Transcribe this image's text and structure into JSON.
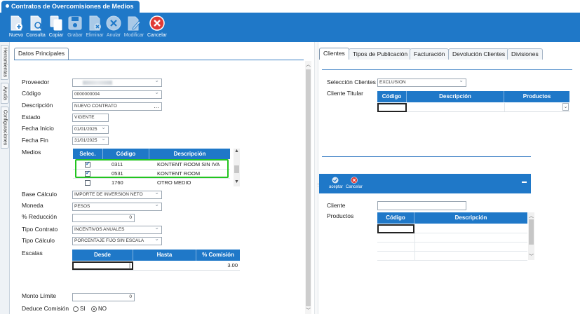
{
  "window": {
    "tab_title": "Contratos de Overcomisiones de Medios"
  },
  "toolbar": [
    {
      "id": "nuevo",
      "label": "Nuevo",
      "icon": "new-document-icon"
    },
    {
      "id": "consulta",
      "label": "Consulta",
      "icon": "search-document-icon"
    },
    {
      "id": "copiar",
      "label": "Copiar",
      "icon": "copy-icon"
    },
    {
      "id": "grabar",
      "label": "Grabar",
      "icon": "save-icon"
    },
    {
      "id": "eliminar",
      "label": "Eliminar",
      "icon": "delete-document-icon"
    },
    {
      "id": "anular",
      "label": "Anular",
      "icon": "cancel-x-icon"
    },
    {
      "id": "modificar",
      "label": "Modificar",
      "icon": "edit-document-icon"
    },
    {
      "id": "cancelar",
      "label": "Cancelar",
      "icon": "red-cancel-icon"
    }
  ],
  "sidebar_tabs": [
    "Herramientas",
    "Ayuda",
    "Configuraciones"
  ],
  "left_panel": {
    "tab": "Datos Principales",
    "labels": {
      "proveedor": "Proveedor",
      "codigo": "Código",
      "descripcion": "Descripción",
      "estado": "Estado",
      "fecha_inicio": "Fecha Inicio",
      "fecha_fin": "Fecha Fin",
      "medios": "Medios",
      "base_calculo": "Base Cálculo",
      "moneda": "Moneda",
      "reduccion": "% Reducción",
      "tipo_contrato": "Tipo Contrato",
      "tipo_calculo": "Tipo Cálculo",
      "escalas": "Escalas",
      "monto_limite": "Monto Límite",
      "deduce_comision": "Deduce Comisión"
    },
    "values": {
      "codigo": "0000000004",
      "descripcion": "NUEVO CONTRATO",
      "estado": "VIGENTE",
      "fecha_inicio": "01/01/2025",
      "fecha_fin": "31/01/2025",
      "base_calculo": "IMPORTE DE INVERSION NETO",
      "moneda": "PESOS",
      "reduccion": "0",
      "tipo_contrato": "INCENTIVOS ANUALES",
      "tipo_calculo": "PORCENTAJE FIJO SIN ESCALA",
      "monto_limite": "0"
    },
    "medios_grid": {
      "headers": [
        "Selec.",
        "Código",
        "Descripción"
      ],
      "rows": [
        {
          "selected": true,
          "codigo": "0311",
          "descripcion": "KONTENT ROOM SIN IVA"
        },
        {
          "selected": true,
          "codigo": "0531",
          "descripcion": "KONTENT ROOM"
        },
        {
          "selected": false,
          "codigo": "1760",
          "descripcion": "OTRO MEDIO"
        }
      ]
    },
    "escalas_grid": {
      "headers": [
        "Desde",
        "Hasta",
        "% Comisión"
      ],
      "rows": [
        {
          "desde": "",
          "hasta": "",
          "comision": "3.00"
        }
      ]
    },
    "deduce_options": {
      "si": "SI",
      "no": "NO",
      "selected": "NO"
    }
  },
  "right_panel": {
    "tabs": [
      "Clientes",
      "Tipos de Publicación",
      "Facturación",
      "Devolución Clientes",
      "Divisiones"
    ],
    "active_tab": "Clientes",
    "labels": {
      "seleccion_clientes": "Selección Clientes",
      "cliente_titular": "Cliente Titular",
      "cliente": "Cliente",
      "productos": "Productos"
    },
    "values": {
      "seleccion_clientes": "EXCLUSION"
    },
    "titular_grid": {
      "headers": [
        "Código",
        "Descripción",
        "Productos"
      ]
    },
    "mini_toolbar": {
      "aceptar": "aceptar",
      "cancelar": "Cancelar"
    },
    "productos_grid": {
      "headers": [
        "Código",
        "Descripción"
      ]
    }
  },
  "colors": {
    "accent": "#1f78c8",
    "highlight": "#22c41f",
    "cancel": "#e03b36"
  }
}
